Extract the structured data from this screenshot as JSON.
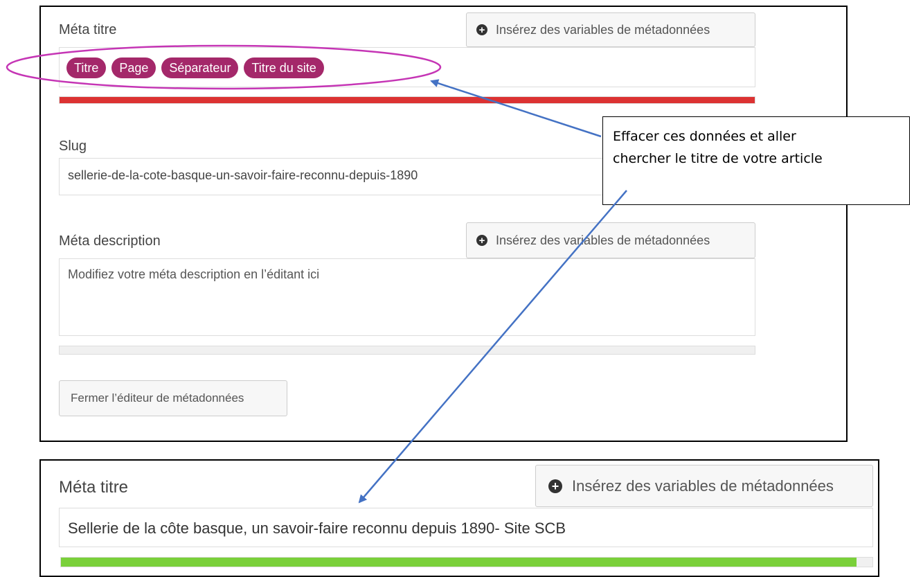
{
  "top_panel": {
    "meta_title": {
      "label": "Méta titre",
      "insert_button": "Insérez des variables de métadonnées",
      "variables": [
        "Titre",
        "Page",
        "Séparateur",
        "Titre du site"
      ],
      "progress": {
        "color": "#dc3232",
        "fraction": 1.0
      }
    },
    "slug": {
      "label": "Slug",
      "value": "sellerie-de-la-cote-basque-un-savoir-faire-reconnu-depuis-1890"
    },
    "meta_description": {
      "label": "Méta description",
      "insert_button": "Insérez des variables de métadonnées",
      "value": "Modifiez votre méta description en l’éditant ici",
      "progress": {
        "fraction": 0.0
      }
    },
    "close_button": "Fermer l’éditeur de métadonnées"
  },
  "callout": {
    "line1": "Effacer ces données et aller",
    "line2": "chercher le titre de votre article"
  },
  "bottom_panel": {
    "meta_title": {
      "label": "Méta titre",
      "insert_button": "Insérez des variables de métadonnées",
      "value": "Sellerie de la côte basque, un savoir-faire reconnu depuis 1890- Site SCB",
      "progress": {
        "color": "#7ad03a",
        "fraction": 0.98
      }
    }
  },
  "colors": {
    "pill": "#a4286a",
    "highlight_ellipse": "#c535b5",
    "arrow": "#4472c4"
  }
}
